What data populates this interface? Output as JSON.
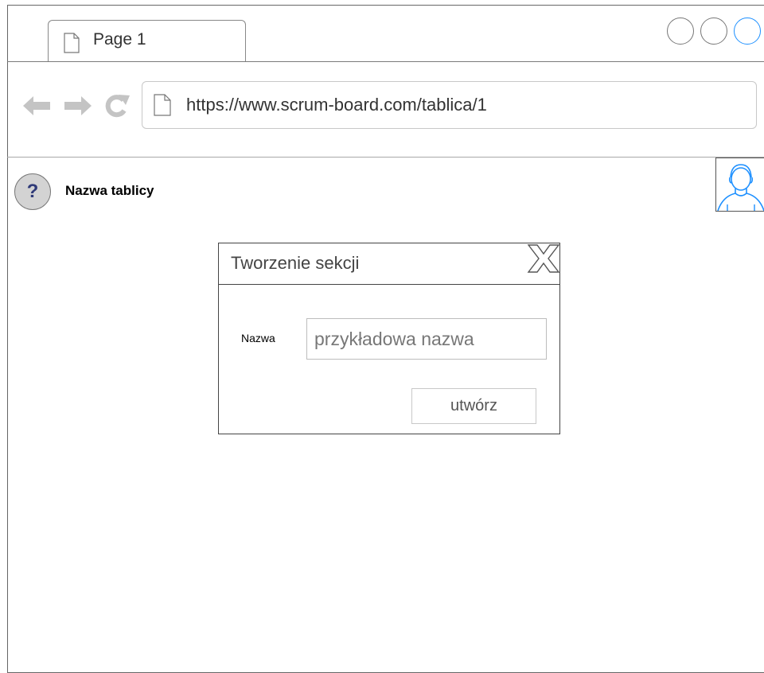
{
  "browser": {
    "tab_title": "Page 1",
    "url": "https://www.scrum-board.com/tablica/1",
    "window_controls": [
      "circle-icon",
      "circle-icon",
      "circle-icon"
    ],
    "nav_icons": [
      "back-arrow-icon",
      "forward-arrow-icon",
      "refresh-icon"
    ]
  },
  "header": {
    "help_symbol": "?",
    "board_name": "Nazwa tablicy",
    "avatar_icon": "user-avatar-icon"
  },
  "dialog": {
    "title": "Tworzenie sekcji",
    "close_icon": "close-icon",
    "name_label": "Nazwa",
    "name_placeholder": "przykładowa nazwa",
    "create_label": "utwórz"
  },
  "colors": {
    "active_window_control": "#1e90ff",
    "help_icon_text": "#2f3a78",
    "avatar_stroke": "#1e90ff"
  }
}
